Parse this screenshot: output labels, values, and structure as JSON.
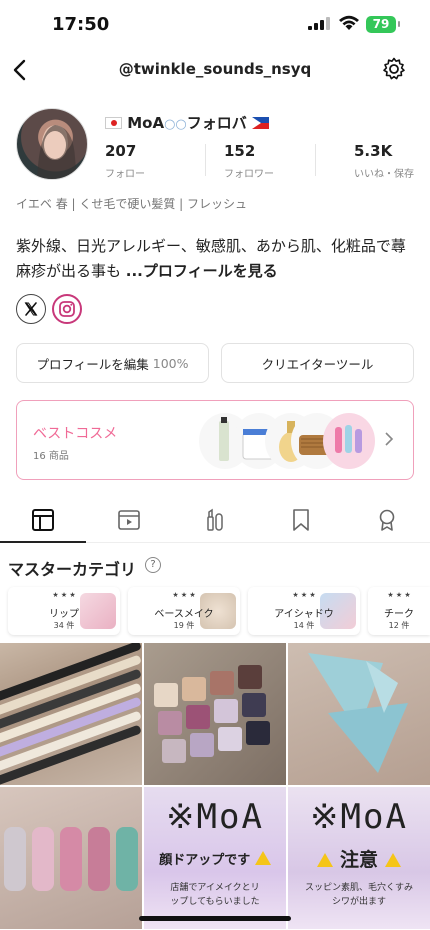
{
  "status_bar": {
    "time": "17:50",
    "battery": "79"
  },
  "header": {
    "handle": "@twinkle_sounds_nsyq"
  },
  "profile": {
    "display_name": "MoA",
    "display_name_suffix": "フォロバ",
    "stats": [
      {
        "value": "207",
        "label": "フォロー"
      },
      {
        "value": "152",
        "label": "フォロワー"
      },
      {
        "value": "5.3K",
        "label": "いいね・保存"
      }
    ],
    "tagline": "イエベ 春 | くせ毛で硬い髪質 | フレッシュ",
    "bio_text": "紫外線、日光アレルギー、敏感肌、あから肌、化粧品で蕁麻疹が出る事も ",
    "bio_more": "...プロフィールを見る"
  },
  "buttons": {
    "edit_profile": "プロフィールを編集",
    "edit_percent": "100%",
    "creator_tools": "クリエイターツール"
  },
  "best_cosme": {
    "title": "ベストコスメ",
    "count": "16 商品"
  },
  "master_category": {
    "title": "マスターカテゴリ",
    "items": [
      {
        "name": "リップ",
        "count": "34 件"
      },
      {
        "name": "ベースメイク",
        "count": "19 件"
      },
      {
        "name": "アイシャドウ",
        "count": "14 件"
      },
      {
        "name": "チーク",
        "count": "12 件"
      }
    ]
  },
  "posts": {
    "moa_text": "※MoA",
    "post5_title": "顔ドアップです",
    "post5_caption": "店舗でアイメイクとリップしてもらいました",
    "post6_title": "注意",
    "post6_caption": "スッピン素肌、毛穴くすみシワが出ます"
  },
  "colors": {
    "accent_pink": "#f06a96",
    "battery_green": "#34c759"
  }
}
